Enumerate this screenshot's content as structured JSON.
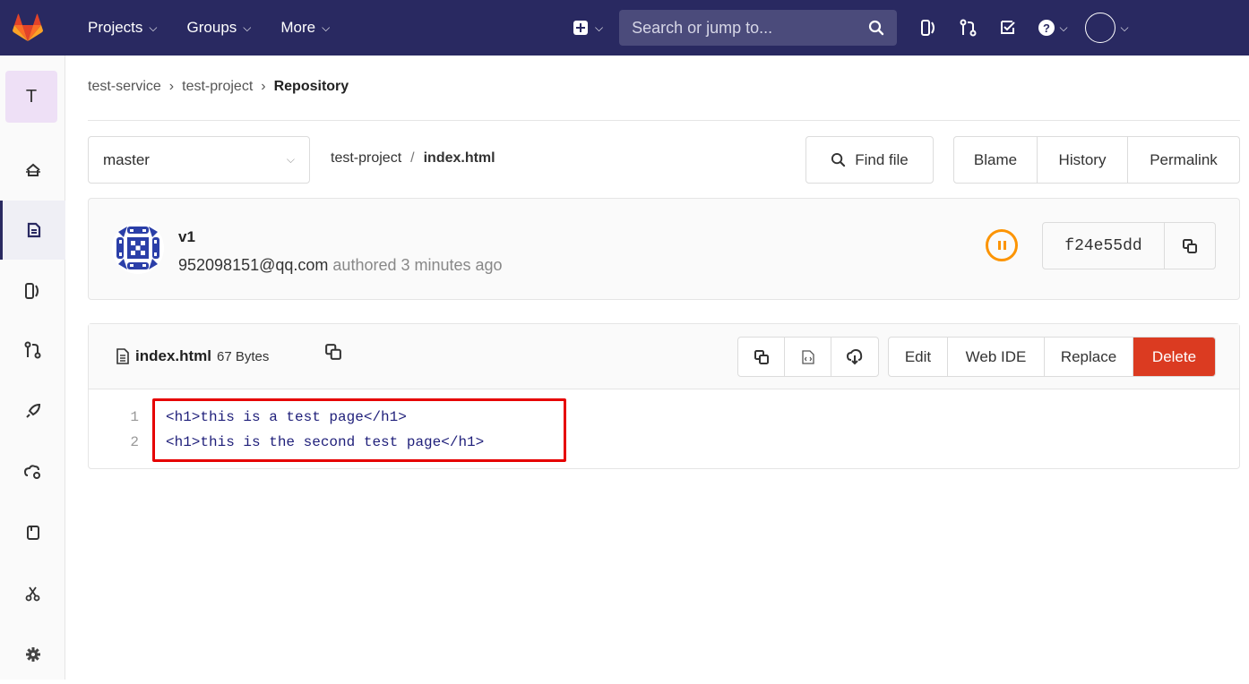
{
  "navbar": {
    "menu": [
      {
        "label": "Projects"
      },
      {
        "label": "Groups"
      },
      {
        "label": "More"
      }
    ],
    "search_placeholder": "Search or jump to...",
    "brand_color": "#292961",
    "icons": [
      "gitlab-logo-icon",
      "plus-square-icon",
      "search-icon",
      "issues-icon",
      "merge-request-icon",
      "todo-icon",
      "help-icon",
      "user-avatar-icon"
    ]
  },
  "sidebar": {
    "project_initial": "T",
    "items": [
      "home-icon",
      "repository-icon",
      "issues-icon",
      "merge-requests-icon",
      "ci-cd-icon",
      "operations-icon",
      "wiki-icon",
      "snippets-icon",
      "settings-icon"
    ]
  },
  "breadcrumb": {
    "items": [
      "test-service",
      "test-project"
    ],
    "current": "Repository"
  },
  "toolbar": {
    "branch": "master",
    "path_project": "test-project",
    "path_separator": "/",
    "path_file": "index.html",
    "find_file_label": "Find file",
    "blame_label": "Blame",
    "history_label": "History",
    "permalink_label": "Permalink"
  },
  "commit": {
    "title": "v1",
    "email": "952098151@qq.com",
    "meta": "authored 3 minutes ago",
    "sha": "f24e55dd",
    "pipeline_status_color": "#fc9403"
  },
  "file": {
    "name": "index.html",
    "size": "67 Bytes",
    "actions": {
      "edit": "Edit",
      "web_ide": "Web IDE",
      "replace": "Replace",
      "delete": "Delete"
    },
    "delete_color": "#db3b21",
    "lines": [
      {
        "number": "1",
        "code": "<h1>this is a test page</h1>"
      },
      {
        "number": "2",
        "code": "<h1>this is the second test page</h1>"
      }
    ]
  }
}
